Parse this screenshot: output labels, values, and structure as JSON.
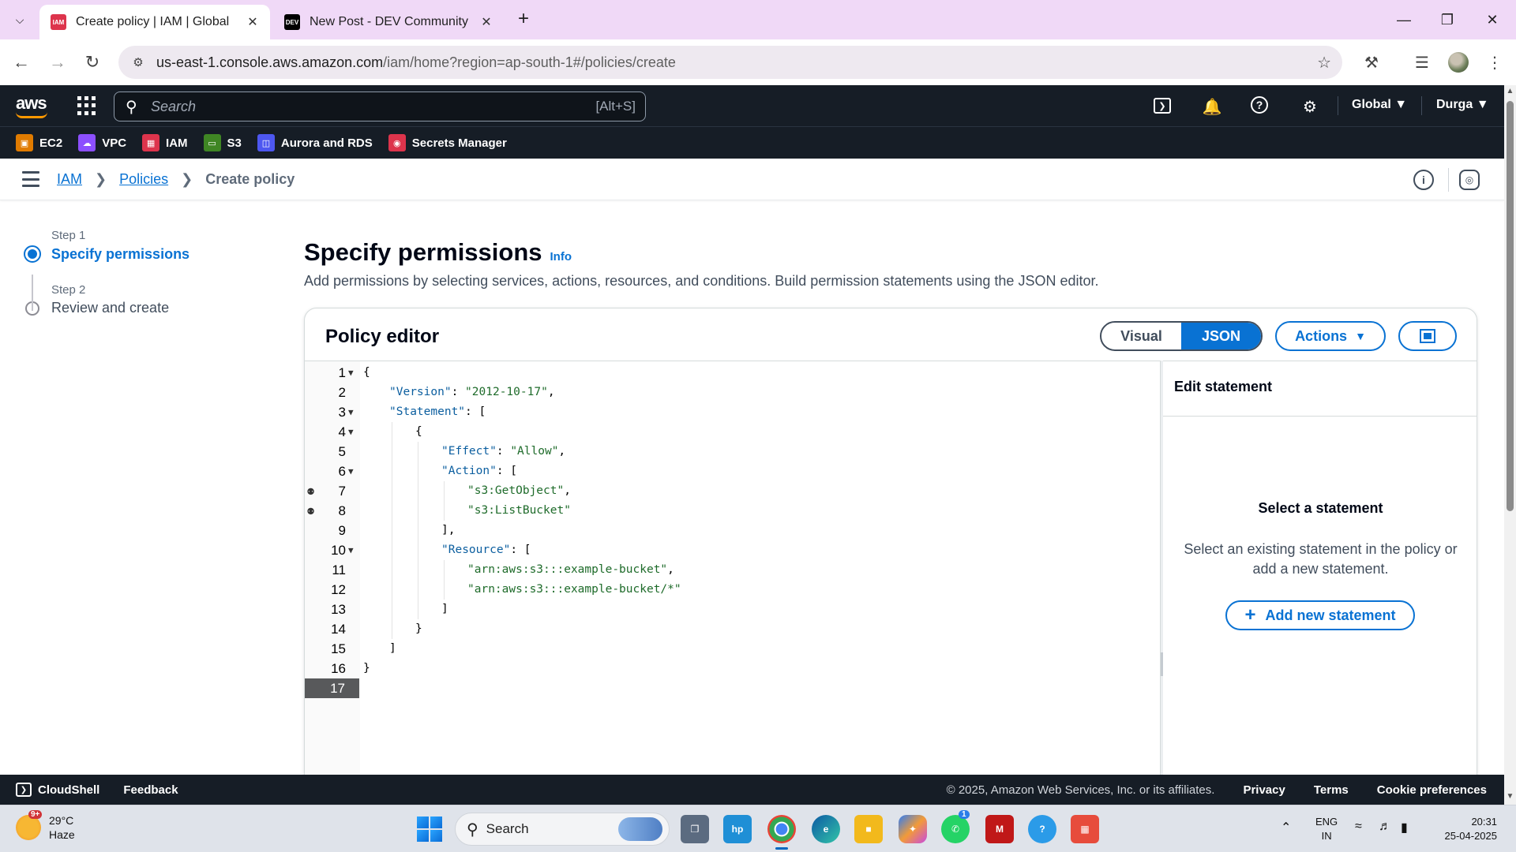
{
  "browser": {
    "tabs": [
      {
        "title": "Create policy | IAM | Global",
        "favicon": "aws-iam-icon",
        "active": true
      },
      {
        "title": "New Post - DEV Community",
        "favicon": "dev-logo-icon",
        "active": false
      }
    ],
    "favicon_iam_text": "IAM",
    "favicon_dev_text": "DEV",
    "url_host": "us-east-1.console.aws.amazon.com",
    "url_path": "/iam/home?region=ap-south-1#/policies/create"
  },
  "aws_header": {
    "logo_text": "aws",
    "search_placeholder": "Search",
    "search_shortcut": "[Alt+S]",
    "region_label": "Global",
    "user_label": "Durga"
  },
  "favorites": [
    {
      "label": "EC2",
      "color": "#e07b00",
      "icon": "ec2-icon"
    },
    {
      "label": "VPC",
      "color": "#8c4fff",
      "icon": "vpc-icon"
    },
    {
      "label": "IAM",
      "color": "#dd344c",
      "icon": "iam-icon"
    },
    {
      "label": "S3",
      "color": "#3f8624",
      "icon": "s3-icon"
    },
    {
      "label": "Aurora and RDS",
      "color": "#4d57f0",
      "icon": "rds-icon"
    },
    {
      "label": "Secrets Manager",
      "color": "#dd344c",
      "icon": "secrets-icon"
    }
  ],
  "breadcrumb": {
    "items": [
      "IAM",
      "Policies"
    ],
    "current": "Create policy"
  },
  "wizard": {
    "step1_label": "Step 1",
    "step1_name": "Specify permissions",
    "step2_label": "Step 2",
    "step2_name": "Review and create"
  },
  "main": {
    "title": "Specify permissions",
    "info": "Info",
    "description": "Add permissions by selecting services, actions, resources, and conditions. Build permission statements using the JSON editor."
  },
  "editor": {
    "title": "Policy editor",
    "mode_visual": "Visual",
    "mode_json": "JSON",
    "actions_label": "Actions",
    "code_lines": [
      {
        "n": "1",
        "indent": 0,
        "fold": true,
        "bulb": false,
        "parts": [
          [
            "p",
            "{"
          ]
        ]
      },
      {
        "n": "2",
        "indent": 1,
        "fold": false,
        "bulb": false,
        "parts": [
          [
            "k",
            "\"Version\""
          ],
          [
            "p",
            ": "
          ],
          [
            "s",
            "\"2012-10-17\""
          ],
          [
            "p",
            ","
          ]
        ]
      },
      {
        "n": "3",
        "indent": 1,
        "fold": true,
        "bulb": false,
        "parts": [
          [
            "k",
            "\"Statement\""
          ],
          [
            "p",
            ": ["
          ]
        ]
      },
      {
        "n": "4",
        "indent": 2,
        "fold": true,
        "bulb": false,
        "parts": [
          [
            "p",
            "{"
          ]
        ]
      },
      {
        "n": "5",
        "indent": 3,
        "fold": false,
        "bulb": false,
        "parts": [
          [
            "k",
            "\"Effect\""
          ],
          [
            "p",
            ": "
          ],
          [
            "s",
            "\"Allow\""
          ],
          [
            "p",
            ","
          ]
        ]
      },
      {
        "n": "6",
        "indent": 3,
        "fold": true,
        "bulb": false,
        "parts": [
          [
            "k",
            "\"Action\""
          ],
          [
            "p",
            ": ["
          ]
        ]
      },
      {
        "n": "7",
        "indent": 4,
        "fold": false,
        "bulb": true,
        "parts": [
          [
            "s",
            "\"s3:GetObject\""
          ],
          [
            "p",
            ","
          ]
        ]
      },
      {
        "n": "8",
        "indent": 4,
        "fold": false,
        "bulb": true,
        "parts": [
          [
            "s",
            "\"s3:ListBucket\""
          ]
        ]
      },
      {
        "n": "9",
        "indent": 3,
        "fold": false,
        "bulb": false,
        "parts": [
          [
            "p",
            "],"
          ]
        ]
      },
      {
        "n": "10",
        "indent": 3,
        "fold": true,
        "bulb": false,
        "parts": [
          [
            "k",
            "\"Resource\""
          ],
          [
            "p",
            ": ["
          ]
        ]
      },
      {
        "n": "11",
        "indent": 4,
        "fold": false,
        "bulb": false,
        "parts": [
          [
            "s",
            "\"arn:aws:s3:::example-bucket\""
          ],
          [
            "p",
            ","
          ]
        ]
      },
      {
        "n": "12",
        "indent": 4,
        "fold": false,
        "bulb": false,
        "parts": [
          [
            "s",
            "\"arn:aws:s3:::example-bucket/*\""
          ]
        ]
      },
      {
        "n": "13",
        "indent": 3,
        "fold": false,
        "bulb": false,
        "parts": [
          [
            "p",
            "]"
          ]
        ]
      },
      {
        "n": "14",
        "indent": 2,
        "fold": false,
        "bulb": false,
        "parts": [
          [
            "p",
            "}"
          ]
        ]
      },
      {
        "n": "15",
        "indent": 1,
        "fold": false,
        "bulb": false,
        "parts": [
          [
            "p",
            "]"
          ]
        ]
      },
      {
        "n": "16",
        "indent": 0,
        "fold": false,
        "bulb": false,
        "parts": [
          [
            "p",
            "}"
          ]
        ]
      },
      {
        "n": "17",
        "indent": 0,
        "fold": false,
        "bulb": false,
        "current": true,
        "parts": []
      }
    ]
  },
  "side_panel": {
    "title": "Edit statement",
    "empty_title": "Select a statement",
    "empty_desc": "Select an existing statement in the policy or add a new statement.",
    "add_button": "Add new statement"
  },
  "footer": {
    "cloudshell": "CloudShell",
    "feedback": "Feedback",
    "copyright": "© 2025, Amazon Web Services, Inc. or its affiliates.",
    "privacy": "Privacy",
    "terms": "Terms",
    "cookies": "Cookie preferences"
  },
  "taskbar": {
    "weather_badge": "9+",
    "temperature": "29°C",
    "condition": "Haze",
    "search": "Search",
    "lang_line1": "ENG",
    "lang_line2": "IN",
    "time": "20:31",
    "date": "25-04-2025",
    "whatsapp_badge": "1"
  }
}
